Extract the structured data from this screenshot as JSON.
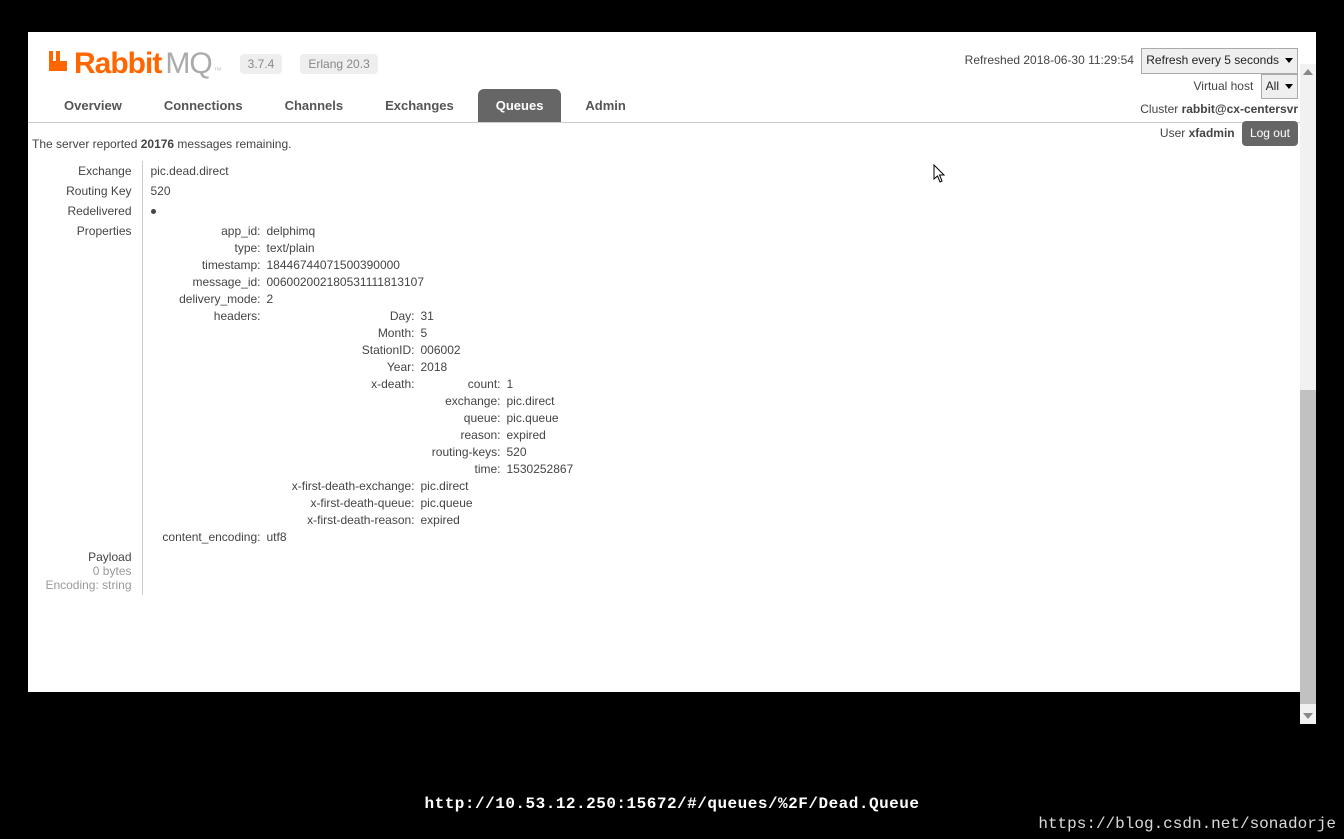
{
  "logo": {
    "part1": "Rabbit",
    "part2": "MQ",
    "tm": "™"
  },
  "versions": {
    "rabbit": "3.7.4",
    "erlang": "Erlang 20.3"
  },
  "status": {
    "refreshed_prefix": "Refreshed ",
    "refreshed_ts": "2018-06-30 11:29:54",
    "refresh_mode": "Refresh every 5 seconds",
    "vhost_label": "Virtual host",
    "vhost_value": "All",
    "cluster_label": "Cluster ",
    "cluster_value": "rabbit@cx-centersvr",
    "user_label": "User ",
    "user_value": "xfadmin",
    "logout": "Log out"
  },
  "tabs": [
    "Overview",
    "Connections",
    "Channels",
    "Exchanges",
    "Queues",
    "Admin"
  ],
  "active_tab": "Queues",
  "remaining": {
    "pre": "The server reported ",
    "count": "20176",
    "post": " messages remaining."
  },
  "rows": {
    "exchange": {
      "label": "Exchange",
      "value": "pic.dead.direct"
    },
    "routing_key": {
      "label": "Routing Key",
      "value": "520"
    },
    "redelivered": {
      "label": "Redelivered"
    },
    "properties": {
      "label": "Properties"
    },
    "payload": {
      "label": "Payload",
      "bytes": "0 bytes",
      "encoding": "Encoding: string"
    }
  },
  "properties": {
    "app_id": "delphimq",
    "type": "text/plain",
    "timestamp": "18446744071500390000",
    "message_id": "006002002180531111813107",
    "delivery_mode": "2",
    "content_encoding": "utf8",
    "headers": {
      "Day": "31",
      "Month": "5",
      "StationID": "006002",
      "Year": "2018",
      "x_death": {
        "count": "1",
        "exchange": "pic.direct",
        "queue": "pic.queue",
        "reason": "expired",
        "routing_keys": "520",
        "time": "1530252867"
      },
      "x_first_death_exchange": "pic.direct",
      "x_first_death_queue": "pic.queue",
      "x_first_death_reason": "expired"
    }
  },
  "labels": {
    "app_id": "app_id:",
    "type": "type:",
    "timestamp": "timestamp:",
    "message_id": "message_id:",
    "delivery_mode": "delivery_mode:",
    "headers": "headers:",
    "content_encoding": "content_encoding:",
    "Day": "Day:",
    "Month": "Month:",
    "StationID": "StationID:",
    "Year": "Year:",
    "x_death": "x-death:",
    "count": "count:",
    "exchange": "exchange:",
    "queue": "queue:",
    "reason": "reason:",
    "routing_keys": "routing-keys:",
    "time": "time:",
    "xfde": "x-first-death-exchange:",
    "xfdq": "x-first-death-queue:",
    "xfdr": "x-first-death-reason:"
  },
  "footer_url": "http://10.53.12.250:15672/#/queues/%2F/Dead.Queue",
  "watermark": "https://blog.csdn.net/sonadorje"
}
